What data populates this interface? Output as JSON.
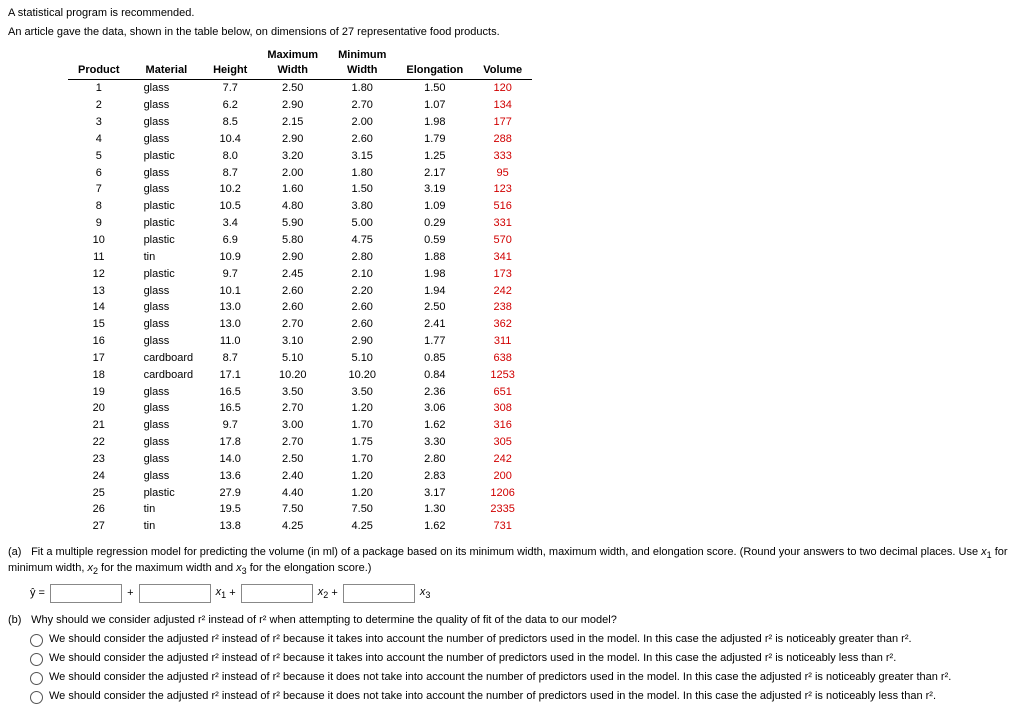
{
  "intro1": "A statistical program is recommended.",
  "intro2": "An article gave the data, shown in the table below, on dimensions of 27 representative food products.",
  "headers": {
    "product": "Product",
    "material": "Material",
    "height": "Height",
    "maxw": "Maximum\nWidth",
    "minw": "Minimum\nWidth",
    "elong": "Elongation",
    "vol": "Volume"
  },
  "rows": [
    {
      "p": "1",
      "m": "glass",
      "h": "7.7",
      "mx": "2.50",
      "mn": "1.80",
      "e": "1.50",
      "v": "120"
    },
    {
      "p": "2",
      "m": "glass",
      "h": "6.2",
      "mx": "2.90",
      "mn": "2.70",
      "e": "1.07",
      "v": "134"
    },
    {
      "p": "3",
      "m": "glass",
      "h": "8.5",
      "mx": "2.15",
      "mn": "2.00",
      "e": "1.98",
      "v": "177"
    },
    {
      "p": "4",
      "m": "glass",
      "h": "10.4",
      "mx": "2.90",
      "mn": "2.60",
      "e": "1.79",
      "v": "288"
    },
    {
      "p": "5",
      "m": "plastic",
      "h": "8.0",
      "mx": "3.20",
      "mn": "3.15",
      "e": "1.25",
      "v": "333"
    },
    {
      "p": "6",
      "m": "glass",
      "h": "8.7",
      "mx": "2.00",
      "mn": "1.80",
      "e": "2.17",
      "v": "95"
    },
    {
      "p": "7",
      "m": "glass",
      "h": "10.2",
      "mx": "1.60",
      "mn": "1.50",
      "e": "3.19",
      "v": "123"
    },
    {
      "p": "8",
      "m": "plastic",
      "h": "10.5",
      "mx": "4.80",
      "mn": "3.80",
      "e": "1.09",
      "v": "516"
    },
    {
      "p": "9",
      "m": "plastic",
      "h": "3.4",
      "mx": "5.90",
      "mn": "5.00",
      "e": "0.29",
      "v": "331"
    },
    {
      "p": "10",
      "m": "plastic",
      "h": "6.9",
      "mx": "5.80",
      "mn": "4.75",
      "e": "0.59",
      "v": "570"
    },
    {
      "p": "11",
      "m": "tin",
      "h": "10.9",
      "mx": "2.90",
      "mn": "2.80",
      "e": "1.88",
      "v": "341"
    },
    {
      "p": "12",
      "m": "plastic",
      "h": "9.7",
      "mx": "2.45",
      "mn": "2.10",
      "e": "1.98",
      "v": "173"
    },
    {
      "p": "13",
      "m": "glass",
      "h": "10.1",
      "mx": "2.60",
      "mn": "2.20",
      "e": "1.94",
      "v": "242"
    },
    {
      "p": "14",
      "m": "glass",
      "h": "13.0",
      "mx": "2.60",
      "mn": "2.60",
      "e": "2.50",
      "v": "238"
    },
    {
      "p": "15",
      "m": "glass",
      "h": "13.0",
      "mx": "2.70",
      "mn": "2.60",
      "e": "2.41",
      "v": "362"
    },
    {
      "p": "16",
      "m": "glass",
      "h": "11.0",
      "mx": "3.10",
      "mn": "2.90",
      "e": "1.77",
      "v": "311"
    },
    {
      "p": "17",
      "m": "cardboard",
      "h": "8.7",
      "mx": "5.10",
      "mn": "5.10",
      "e": "0.85",
      "v": "638"
    },
    {
      "p": "18",
      "m": "cardboard",
      "h": "17.1",
      "mx": "10.20",
      "mn": "10.20",
      "e": "0.84",
      "v": "1253"
    },
    {
      "p": "19",
      "m": "glass",
      "h": "16.5",
      "mx": "3.50",
      "mn": "3.50",
      "e": "2.36",
      "v": "651"
    },
    {
      "p": "20",
      "m": "glass",
      "h": "16.5",
      "mx": "2.70",
      "mn": "1.20",
      "e": "3.06",
      "v": "308"
    },
    {
      "p": "21",
      "m": "glass",
      "h": "9.7",
      "mx": "3.00",
      "mn": "1.70",
      "e": "1.62",
      "v": "316"
    },
    {
      "p": "22",
      "m": "glass",
      "h": "17.8",
      "mx": "2.70",
      "mn": "1.75",
      "e": "3.30",
      "v": "305"
    },
    {
      "p": "23",
      "m": "glass",
      "h": "14.0",
      "mx": "2.50",
      "mn": "1.70",
      "e": "2.80",
      "v": "242"
    },
    {
      "p": "24",
      "m": "glass",
      "h": "13.6",
      "mx": "2.40",
      "mn": "1.20",
      "e": "2.83",
      "v": "200"
    },
    {
      "p": "25",
      "m": "plastic",
      "h": "27.9",
      "mx": "4.40",
      "mn": "1.20",
      "e": "3.17",
      "v": "1206"
    },
    {
      "p": "26",
      "m": "tin",
      "h": "19.5",
      "mx": "7.50",
      "mn": "7.50",
      "e": "1.30",
      "v": "2335"
    },
    {
      "p": "27",
      "m": "tin",
      "h": "13.8",
      "mx": "4.25",
      "mn": "4.25",
      "e": "1.62",
      "v": "731"
    }
  ],
  "qa": {
    "label": "(a)",
    "text1": "Fit a multiple regression model for predicting the volume (in ml) of a package based on its minimum width, maximum width, and elongation score. (Round your answers to two decimal places. Use ",
    "x1": "x",
    "s1": "1",
    "text2": " for minimum width, ",
    "x2": "x",
    "s2": "2",
    "text3": " for the maximum width and ",
    "x3": "x",
    "s3": "3",
    "text4": " for the elongation score.)",
    "yhat": "ŷ ="
  },
  "eq": {
    "plus": " + ",
    "x1": "x",
    "s1": "1",
    "x2": "x",
    "s2": "2",
    "x3": "x",
    "s3": "3"
  },
  "qb": {
    "label": "(b)",
    "text": "Why should we consider adjusted r² instead of r² when attempting to determine the quality of fit of the data to our model?",
    "o1": "We should consider the adjusted r² instead of r² because it takes into account the number of predictors used in the model. In this case the adjusted r² is noticeably greater than r².",
    "o2": "We should consider the adjusted r² instead of r² because it takes into account the number of predictors used in the model. In this case the adjusted r² is noticeably less than r².",
    "o3": "We should consider the adjusted r² instead of r² because it does not take into account the number of predictors used in the model. In this case the adjusted r² is noticeably greater than r².",
    "o4": "We should consider the adjusted r² instead of r² because it does not take into account the number of predictors used in the model. In this case the adjusted r² is noticeably less than r²."
  }
}
